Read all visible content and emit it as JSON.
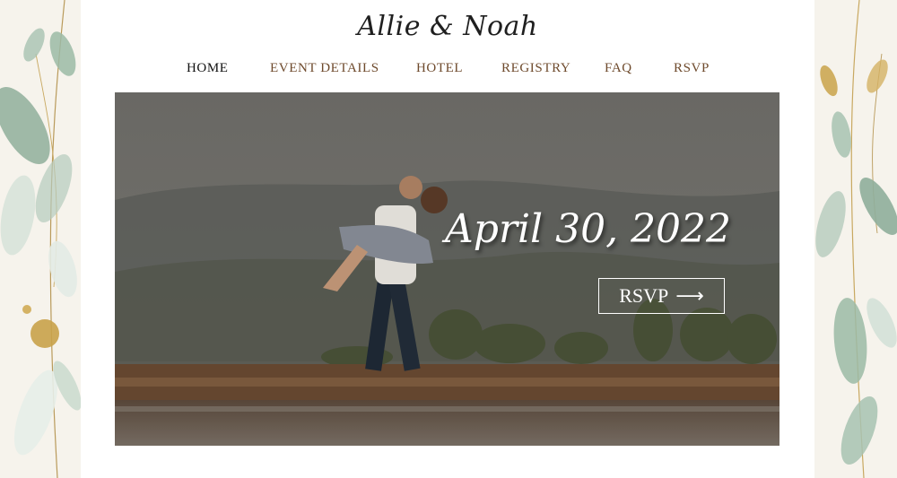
{
  "site": {
    "title": "Allie & Noah"
  },
  "nav": {
    "items": [
      {
        "label": "HOME",
        "active": true
      },
      {
        "label": "EVENT DETAILS",
        "active": false
      },
      {
        "label": "HOTEL",
        "active": false
      },
      {
        "label": "REGISTRY",
        "active": false
      },
      {
        "label": "FAQ",
        "active": false
      },
      {
        "label": "RSVP",
        "active": false
      }
    ]
  },
  "hero": {
    "date": "April 30, 2022",
    "rsvp_label": "RSVP",
    "rsvp_icon": "arrow-right-icon"
  },
  "decor": {
    "left": "eucalyptus-leaves-illustration",
    "right": "eucalyptus-leaves-illustration"
  },
  "colors": {
    "nav_text": "#6e4a2c",
    "nav_active": "#111111",
    "accent_gold": "#c9a24a",
    "leaf_green": "#8fae9b"
  }
}
